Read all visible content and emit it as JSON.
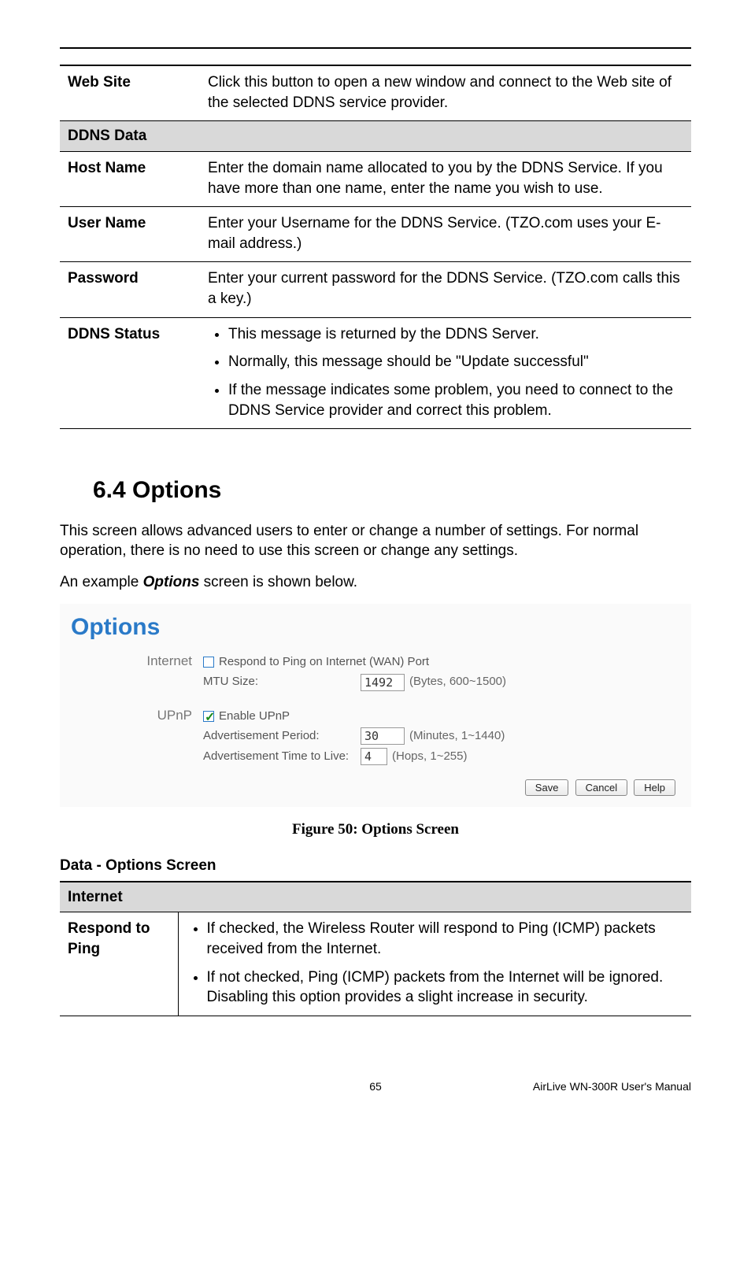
{
  "table1": {
    "rows": [
      {
        "label": "Web Site",
        "text": "Click this button to open a new window and connect to the Web site of the selected DDNS service provider."
      }
    ],
    "section_header": "DDNS Data",
    "rows2": [
      {
        "label": "Host Name",
        "text": "Enter the domain name allocated to you by the DDNS Service. If you have more than one name, enter the name you wish to use."
      },
      {
        "label": "User Name",
        "text": "Enter your Username for the DDNS Service. (TZO.com uses your E-mail address.)"
      },
      {
        "label": "Password",
        "text": "Enter your current password for the DDNS Service. (TZO.com calls this a key.)"
      }
    ],
    "status_label": "DDNS Status",
    "status_items": [
      "This message is returned by the DDNS Server.",
      "Normally, this message should be \"Update successful\"",
      "If the message indicates some problem, you need to connect to the DDNS Service provider and correct this problem."
    ]
  },
  "section_heading": "6.4  Options",
  "intro_p1": "This screen allows advanced users to enter or change a number of settings. For normal operation, there is no need to use this screen or change any settings.",
  "intro_p2_a": "An example ",
  "intro_p2_b": "Options",
  "intro_p2_c": " screen is shown below.",
  "screenshot": {
    "title": "Options",
    "internet": {
      "label": "Internet",
      "ping_label": "Respond to Ping on Internet (WAN) Port",
      "ping_checked": false,
      "mtu_label": "MTU Size:",
      "mtu_value": "1492",
      "mtu_hint": "(Bytes, 600~1500)"
    },
    "upnp": {
      "label": "UPnP",
      "enable_label": "Enable UPnP",
      "enable_checked": true,
      "adv_period_label": "Advertisement Period:",
      "adv_period_value": "30",
      "adv_period_hint": "(Minutes, 1~1440)",
      "adv_ttl_label": "Advertisement Time to Live:",
      "adv_ttl_value": "4",
      "adv_ttl_hint": "(Hops, 1~255)"
    },
    "buttons": {
      "save": "Save",
      "cancel": "Cancel",
      "help": "Help"
    }
  },
  "figure_caption": "Figure 50: Options Screen",
  "data_title": "Data - Options Screen",
  "table2": {
    "section_header": "Internet",
    "row_label": "Respond to Ping",
    "items": [
      "If checked, the Wireless Router will respond to Ping (ICMP) packets received from the Internet.",
      "If not checked, Ping (ICMP) packets from the Internet will be ignored. Disabling this option provides a slight increase in security."
    ]
  },
  "footer": {
    "page": "65",
    "manual": "AirLive WN-300R User's Manual"
  }
}
